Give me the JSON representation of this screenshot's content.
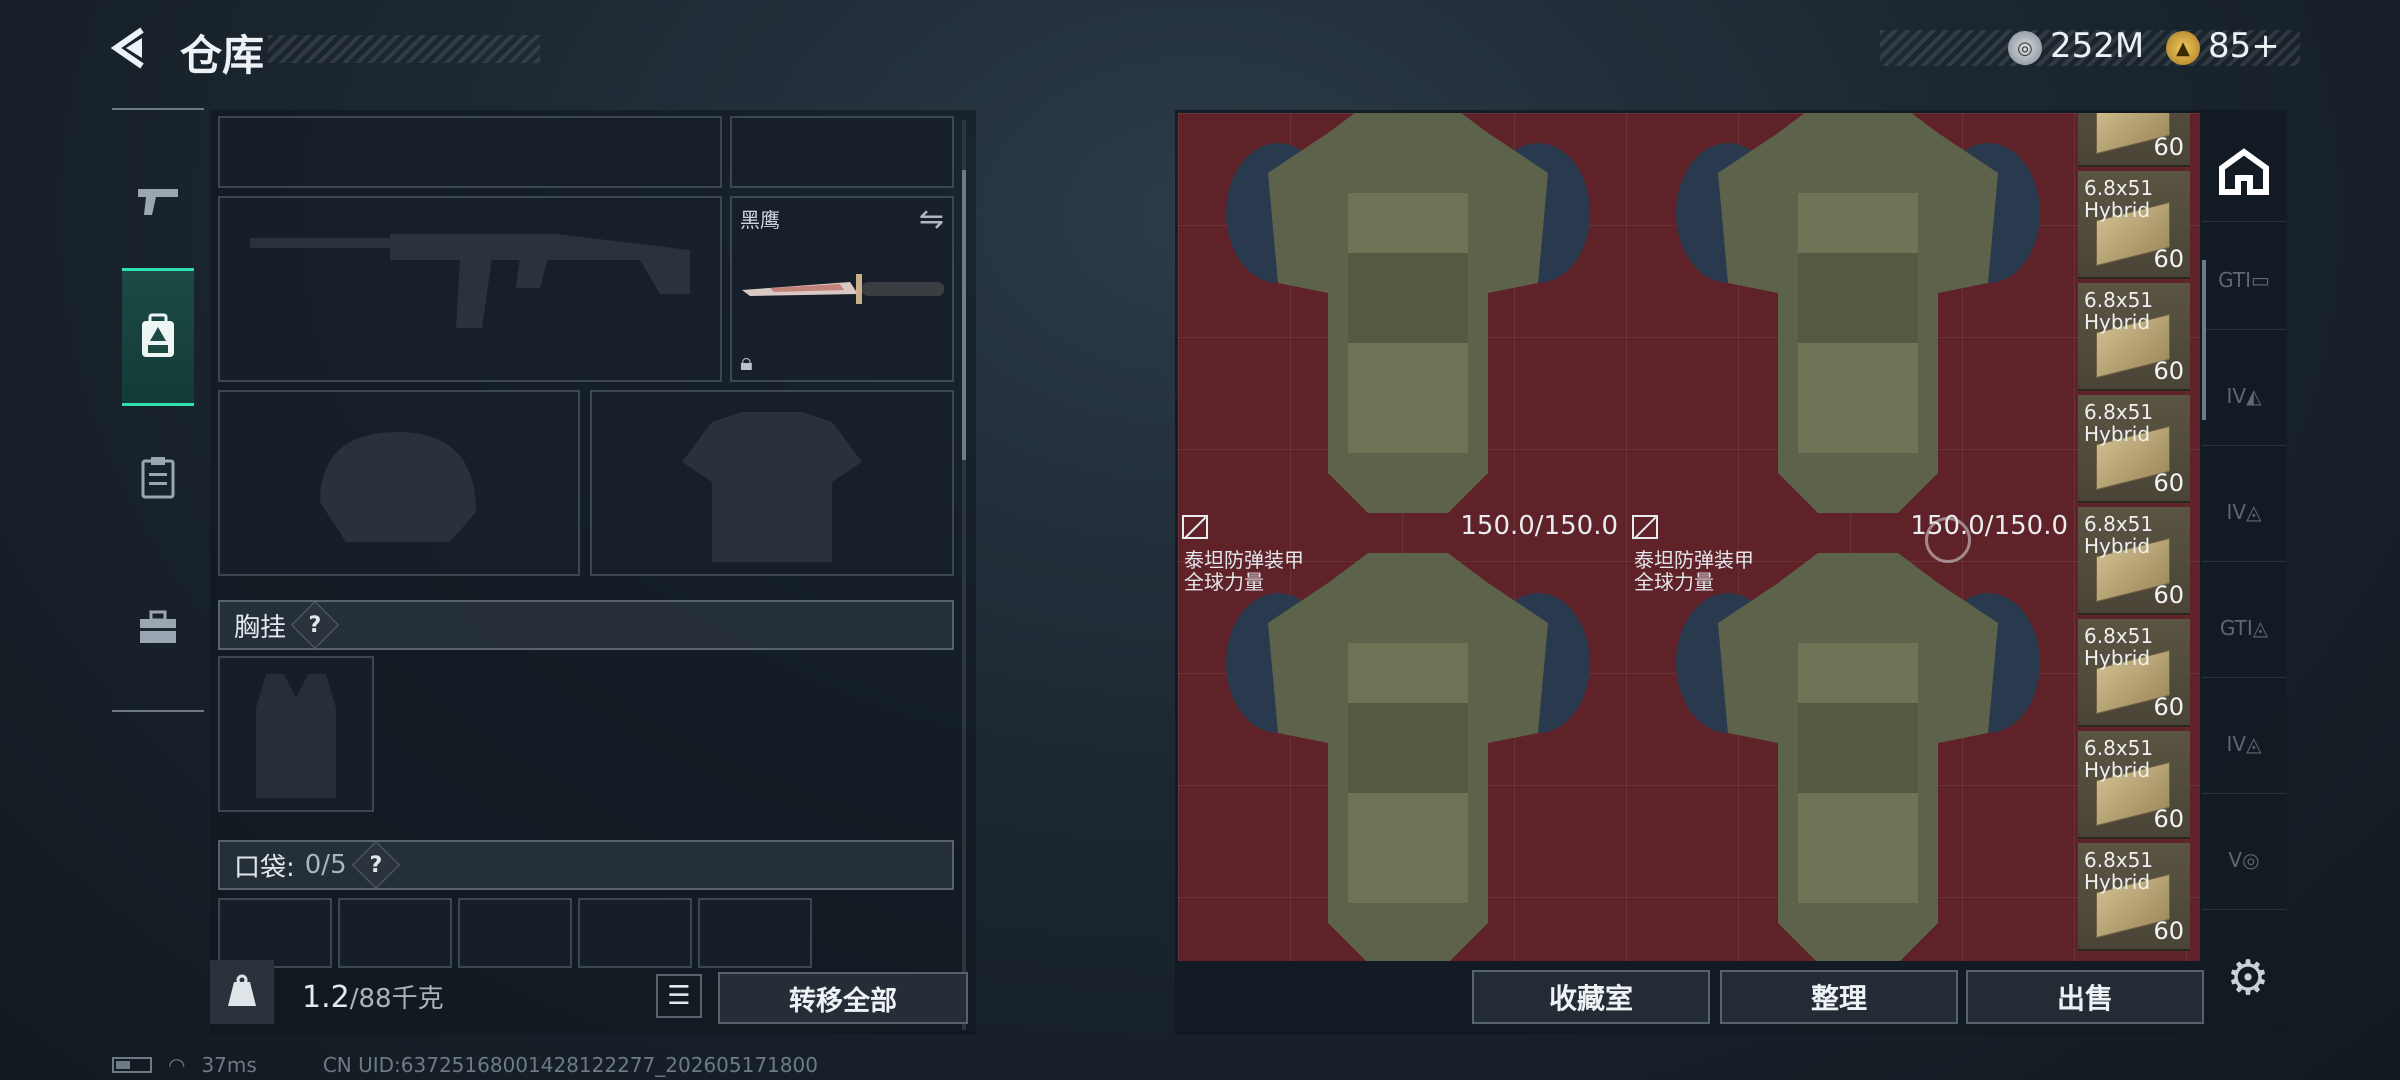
{
  "header": {
    "title": "仓库",
    "currency1_value": "252M",
    "currency2_value": "85+"
  },
  "left_nav": {
    "items": [
      "weapon-icon",
      "backpack-icon",
      "clipboard-icon",
      "toolbox-icon"
    ]
  },
  "loadout": {
    "knife_name": "黑鹰",
    "rig_section_label": "胸挂",
    "pockets_label": "口袋:",
    "pockets_count": "0/5",
    "help_glyph": "?",
    "weight_value": "1.2",
    "weight_capacity": "/88千克",
    "transfer_all_label": "转移全部"
  },
  "stash": {
    "armor_items": [
      {
        "name": "",
        "durability": "150.0/150.0"
      },
      {
        "name": "",
        "durability": "150.0/150.0"
      },
      {
        "name": "泰坦防弹装甲\n全球力量",
        "durability": "150.0/150.0"
      },
      {
        "name": "泰坦防弹装甲\n全球力量",
        "durability": "150.0/150.0"
      }
    ],
    "ammo_items": [
      {
        "name": "",
        "count": "60"
      },
      {
        "name": "6.8x51\nHybrid",
        "count": "60"
      },
      {
        "name": "6.8x51\nHybrid",
        "count": "60"
      },
      {
        "name": "6.8x51\nHybrid",
        "count": "60"
      },
      {
        "name": "6.8x51\nHybrid",
        "count": "60"
      },
      {
        "name": "6.8x51\nHybrid",
        "count": "60"
      },
      {
        "name": "6.8x51\nHybrid",
        "count": "60"
      },
      {
        "name": "6.8x51\nHybrid",
        "count": "60"
      }
    ],
    "collection_label": "收藏室",
    "sort_label": "整理",
    "sell_label": "出售"
  },
  "right_tabs": [
    "home-icon",
    "GTI",
    "IV",
    "IV",
    "GTI",
    "IV",
    "V"
  ],
  "status_bar": {
    "ping": "37ms",
    "uid": "CN UID:63725168001428122277_202605171800"
  },
  "colors": {
    "accent": "#2ee0b0",
    "stash_bg": "#5e2228"
  }
}
